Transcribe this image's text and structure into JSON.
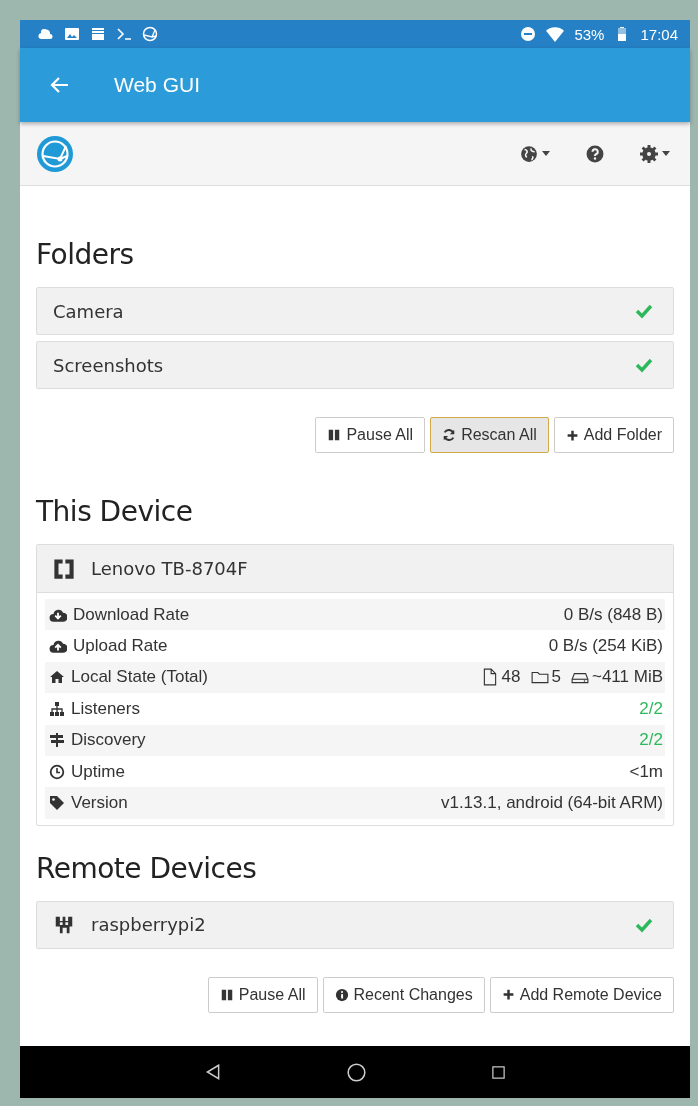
{
  "status_bar": {
    "battery": "53%",
    "time": "17:04"
  },
  "app_bar": {
    "title": "Web GUI"
  },
  "folders": {
    "heading": "Folders",
    "items": [
      {
        "name": "Camera",
        "synced": true
      },
      {
        "name": "Screenshots",
        "synced": true
      }
    ],
    "buttons": [
      {
        "label": "Pause All",
        "focused": false
      },
      {
        "label": "Rescan All",
        "focused": true
      },
      {
        "label": "Add Folder",
        "focused": false
      }
    ]
  },
  "this_device": {
    "heading": "This Device",
    "name": "Lenovo TB-8704F",
    "rows": [
      {
        "label": "Download Rate",
        "value": "0 B/s (848 B)",
        "ok": false
      },
      {
        "label": "Upload Rate",
        "value": "0 B/s (254 KiB)",
        "ok": false
      },
      {
        "label": "Local State (Total)",
        "parts": [
          "48",
          "5",
          "~411 MiB"
        ],
        "ok": false
      },
      {
        "label": "Listeners",
        "value": "2/2",
        "ok": true
      },
      {
        "label": "Discovery",
        "value": "2/2",
        "ok": true
      },
      {
        "label": "Uptime",
        "value": "<1m",
        "ok": false
      },
      {
        "label": "Version",
        "value": "v1.13.1, android (64-bit ARM)",
        "ok": false
      }
    ]
  },
  "remote_devices": {
    "heading": "Remote Devices",
    "items": [
      {
        "name": "raspberrypi2",
        "synced": true
      }
    ],
    "buttons": [
      {
        "label": "Pause All",
        "focused": false
      },
      {
        "label": "Recent Changes",
        "focused": false
      },
      {
        "label": "Add Remote Device",
        "focused": false
      }
    ]
  }
}
